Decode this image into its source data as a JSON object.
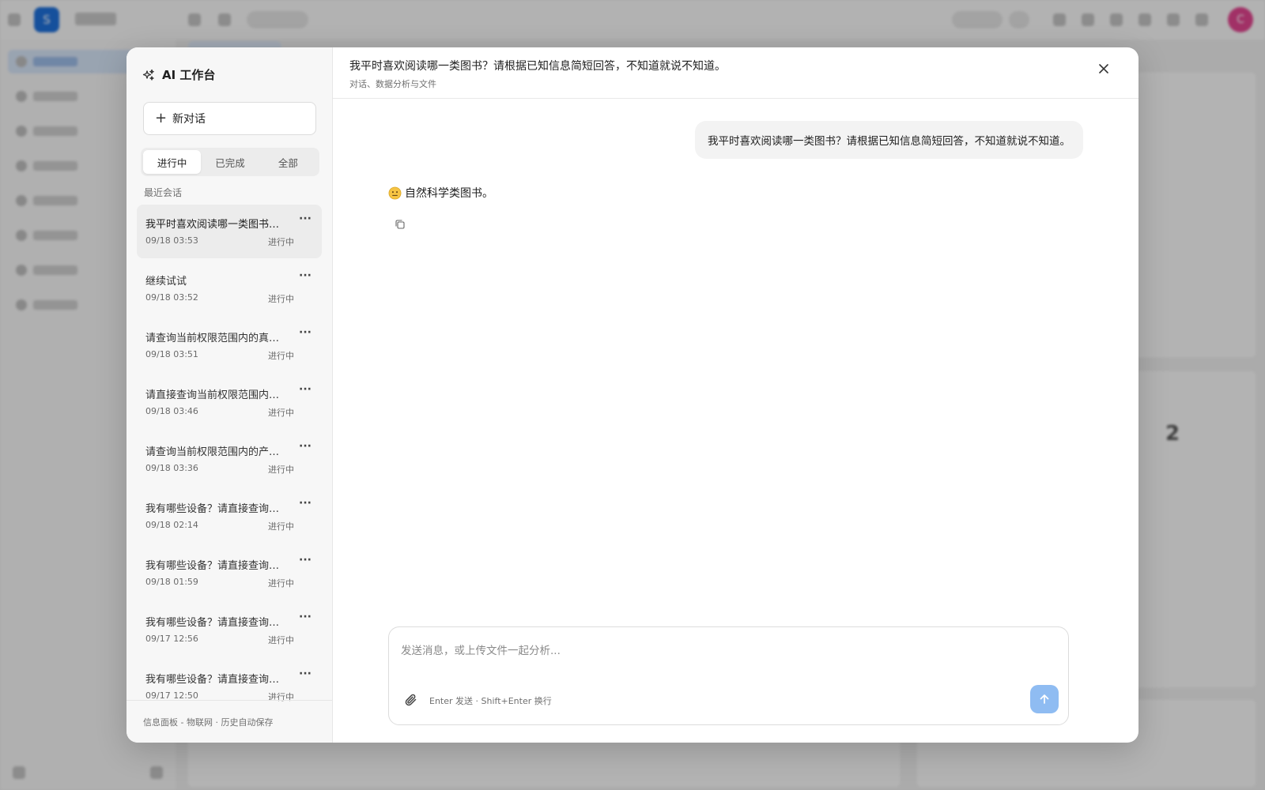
{
  "background": {
    "logo_letter": "S",
    "avatar_letter": "C",
    "big_number": "2"
  },
  "workbench": {
    "title": "AI 工作台",
    "new_chat_label": "新对话",
    "filters": [
      "进行中",
      "已完成",
      "全部"
    ],
    "active_filter": "进行中",
    "section_label": "最近会话",
    "conversations": [
      {
        "title": "我平时喜欢阅读哪一类图书？请根据已知信息简短回答，不知道就说不知道。",
        "time": "09/18 03:53",
        "status": "进行中",
        "active": true
      },
      {
        "title": "继续试试",
        "time": "09/18 03:52",
        "status": "进行中"
      },
      {
        "title": "请查询当前权限范围内的真实数据",
        "time": "09/18 03:51",
        "status": "进行中"
      },
      {
        "title": "请直接查询当前权限范围内的数据",
        "time": "09/18 03:46",
        "status": "进行中"
      },
      {
        "title": "请查询当前权限范围内的产品数据",
        "time": "09/18 03:36",
        "status": "进行中"
      },
      {
        "title": "我有哪些设备？请直接查询当前权限",
        "time": "09/18 02:14",
        "status": "进行中"
      },
      {
        "title": "我有哪些设备？请直接查询当前权限",
        "time": "09/18 01:59",
        "status": "进行中"
      },
      {
        "title": "我有哪些设备？请直接查询当前权限",
        "time": "09/17 12:56",
        "status": "进行中"
      },
      {
        "title": "我有哪些设备？请直接查询当前权限",
        "time": "09/17 12:50",
        "status": "进行中"
      }
    ],
    "footer": "信息面板 - 物联网 · 历史自动保存"
  },
  "chat": {
    "title": "我平时喜欢阅读哪一类图书？请根据已知信息简短回答，不知道就说不知道。",
    "subtitle": "对话、数据分析与文件",
    "user_message": "我平时喜欢阅读哪一类图书？请根据已知信息简短回答，不知道就说不知道。",
    "ai_reply": "自然科学类图书。",
    "composer_placeholder": "发送消息，或上传文件一起分析...",
    "composer_hint": "Enter 发送 · Shift+Enter 换行"
  },
  "colors": {
    "accent": "#1e6fd9",
    "send_button": "#8fbcf2",
    "avatar": "#e0448e"
  }
}
